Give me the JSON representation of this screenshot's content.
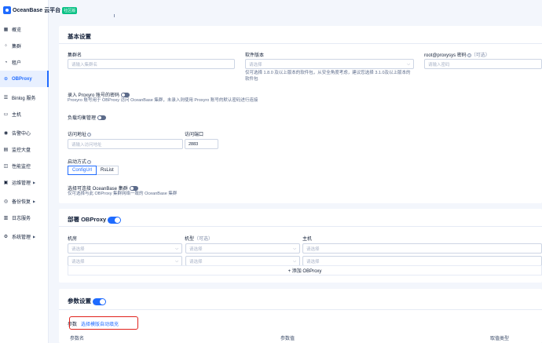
{
  "brand": {
    "name": "OceanBase 云平台",
    "badge": "社区版"
  },
  "sidebar": {
    "items": [
      {
        "label": "概览",
        "icon": "overview-icon",
        "active": false,
        "arrow": false
      },
      {
        "label": "集群",
        "icon": "cluster-icon",
        "active": false,
        "arrow": false
      },
      {
        "label": "租户",
        "icon": "tenant-icon",
        "active": false,
        "arrow": false
      },
      {
        "label": "OBProxy",
        "icon": "obproxy-icon",
        "active": true,
        "arrow": false
      },
      {
        "label": "Binlog 服务",
        "icon": "binlog-icon",
        "active": false,
        "arrow": false
      },
      {
        "label": "主机",
        "icon": "host-icon",
        "active": false,
        "arrow": false
      },
      {
        "label": "告警中心",
        "icon": "alarm-icon",
        "active": false,
        "arrow": false
      },
      {
        "label": "监控大盘",
        "icon": "monitor-icon",
        "active": false,
        "arrow": false
      },
      {
        "label": "性能监控",
        "icon": "performance-icon",
        "active": false,
        "arrow": false
      },
      {
        "label": "运维管理",
        "icon": "ops-icon",
        "active": false,
        "arrow": true
      },
      {
        "label": "备份恢复",
        "icon": "backup-icon",
        "active": false,
        "arrow": true
      },
      {
        "label": "日志服务",
        "icon": "log-icon",
        "active": false,
        "arrow": false
      },
      {
        "label": "系统管理",
        "icon": "system-icon",
        "active": false,
        "arrow": true
      }
    ]
  },
  "basic": {
    "title": "基本设置",
    "cluster_name": {
      "label": "集群名",
      "placeholder": "请输入集群名"
    },
    "version": {
      "label": "软件版本",
      "placeholder": "请选择",
      "hint": "仅可选择 1.8.0 及以上版本的软件包，从安全角度考虑，建议您选择 3.1.0及以上版本的软件包"
    },
    "root_pwd": {
      "label": "root@proxysys 密码",
      "optional": "（可选）",
      "placeholder": "请输入密码"
    },
    "proxyro": {
      "label": "录入 Proxyro 账号的密码",
      "hint": "Proxyro 账号用于 OBProxy 访问 OceanBase 集群，未录入则使用 Proxyro 账号的默认密码进行连接"
    },
    "lb": {
      "label": "负载均衡管理"
    },
    "address": {
      "label": "访问地址",
      "placeholder": "请输入访问地址"
    },
    "port": {
      "label": "访问端口",
      "value": "2883"
    },
    "start_mode": {
      "label": "启动方式",
      "options": [
        "ConfigUrl",
        "RsList"
      ]
    },
    "connect": {
      "label": "选择可连接 OceanBase 集群",
      "hint": "仅可选择与此 OBProxy 集群网络一致的 OceanBase 集群"
    }
  },
  "deploy": {
    "title": "部署 OBProxy",
    "col_room": "机房",
    "col_model": "机型",
    "col_model_opt": "（可选）",
    "col_host": "主机",
    "select_placeholder": "请选择",
    "add_label": "+ 添加 OBProxy"
  },
  "params": {
    "title": "参数设置",
    "param_label": "参数",
    "template_link": "选择模版自动填充",
    "col_name": "参数名",
    "col_value": "参数值",
    "col_type": "取值类型"
  }
}
